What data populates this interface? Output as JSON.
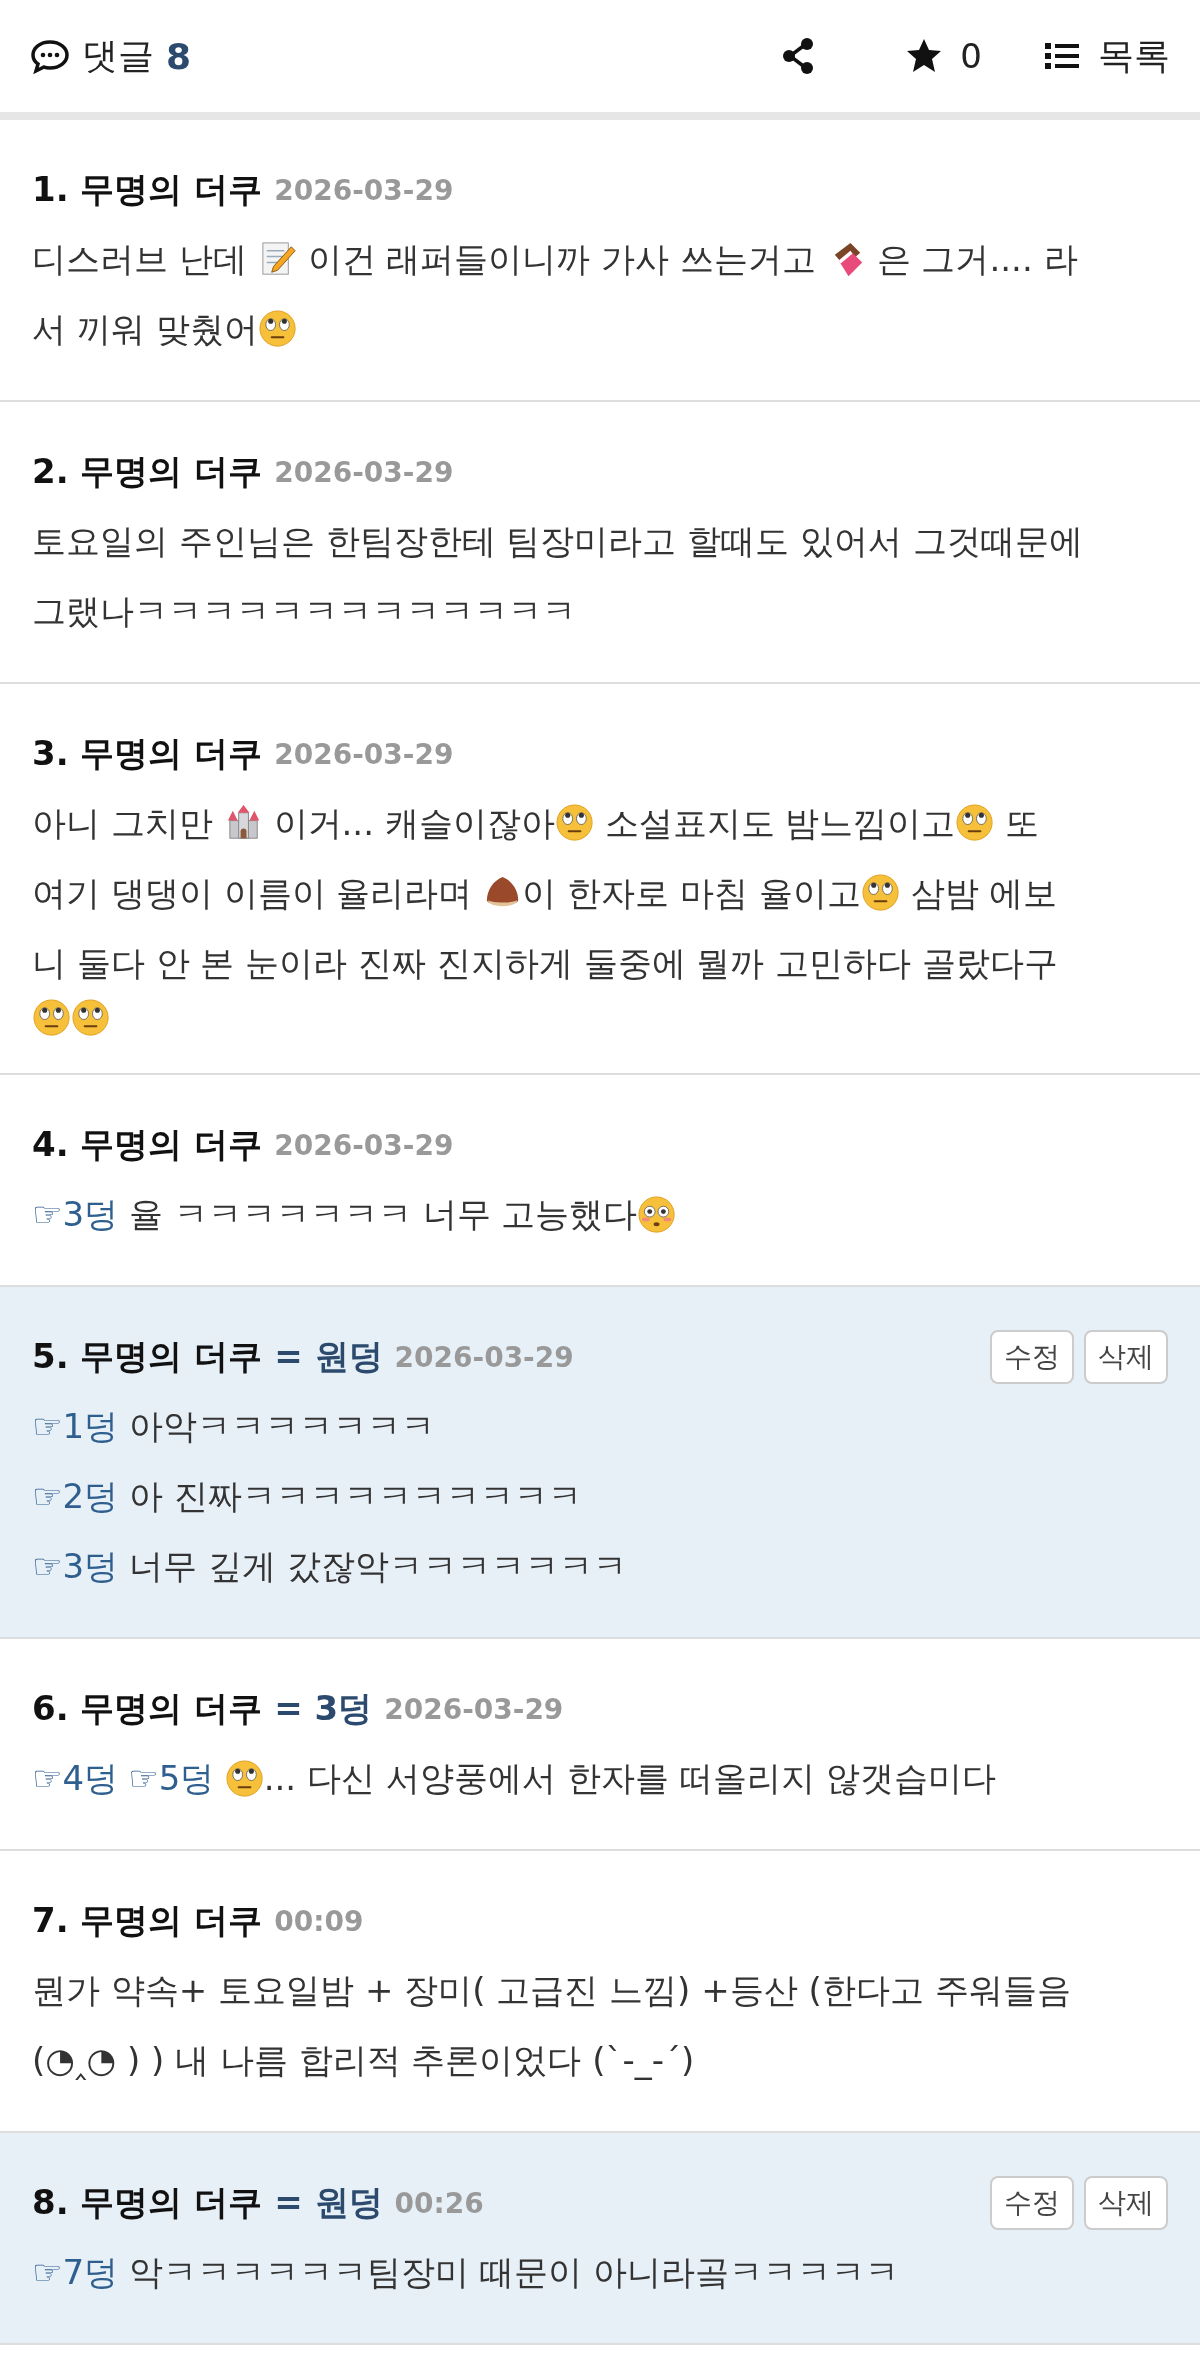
{
  "header": {
    "comments_label": "댓글",
    "comment_count": "8",
    "star_count": "0",
    "list_label": "목록"
  },
  "comments": [
    {
      "number": "1.",
      "author": "무명의 더쿠",
      "date": "2026-03-29",
      "highlighted": false,
      "lines": [
        [
          {
            "kind": "text",
            "text": "디스러브 난데 "
          },
          {
            "kind": "memo"
          },
          {
            "kind": "text",
            "text": " 이건 래퍼들이니까 가사 쓰는거고 "
          },
          {
            "kind": "chocolate"
          },
          {
            "kind": "text",
            "text": " 은 그거.... 라"
          }
        ],
        [
          {
            "kind": "text",
            "text": "서 끼워 맞췄어"
          },
          {
            "kind": "eyeroll"
          }
        ]
      ]
    },
    {
      "number": "2.",
      "author": "무명의 더쿠",
      "date": "2026-03-29",
      "highlighted": false,
      "lines": [
        [
          {
            "kind": "text",
            "text": "토요일의 주인님은 한팀장한테 팀장미라고 할때도 있어서 그것때문에"
          }
        ],
        [
          {
            "kind": "text",
            "text": "그랬나ㅋㅋㅋㅋㅋㅋㅋㅋㅋㅋㅋㅋㅋ"
          }
        ]
      ]
    },
    {
      "number": "3.",
      "author": "무명의 더쿠",
      "date": "2026-03-29",
      "highlighted": false,
      "lines": [
        [
          {
            "kind": "text",
            "text": "아니 그치만 "
          },
          {
            "kind": "castle"
          },
          {
            "kind": "text",
            "text": " 이거... 캐슬이잖아"
          },
          {
            "kind": "eyeroll"
          },
          {
            "kind": "text",
            "text": " 소설표지도 밤느낌이고"
          },
          {
            "kind": "eyeroll"
          },
          {
            "kind": "text",
            "text": " 또"
          }
        ],
        [
          {
            "kind": "text",
            "text": "여기 댕댕이 이름이 율리라며 "
          },
          {
            "kind": "chestnut"
          },
          {
            "kind": "text",
            "text": "이 한자로 마침 율이고"
          },
          {
            "kind": "eyeroll"
          },
          {
            "kind": "text",
            "text": " 삼밤 에보"
          }
        ],
        [
          {
            "kind": "text",
            "text": "니 둘다 안 본 눈이라 진짜 진지하게 둘중에 뭘까 고민하다 골랐다구"
          }
        ],
        [
          {
            "kind": "eyeroll"
          },
          {
            "kind": "eyeroll"
          }
        ]
      ]
    },
    {
      "number": "4.",
      "author": "무명의 더쿠",
      "date": "2026-03-29",
      "highlighted": false,
      "lines": [
        [
          {
            "kind": "ref",
            "text": "☞3덩"
          },
          {
            "kind": "text",
            "text": " 율 ㅋㅋㅋㅋㅋㅋㅋ 너무 고능했다"
          },
          {
            "kind": "flushed"
          }
        ]
      ]
    },
    {
      "number": "5.",
      "author": "무명의 더쿠",
      "tag": "= 원덩",
      "date": "2026-03-29",
      "highlighted": true,
      "buttons": [
        "수정",
        "삭제"
      ],
      "lines": [
        [
          {
            "kind": "ref",
            "text": "☞1덩"
          },
          {
            "kind": "text",
            "text": " 아악ㅋㅋㅋㅋㅋㅋㅋ"
          }
        ],
        [
          {
            "kind": "ref",
            "text": "☞2덩"
          },
          {
            "kind": "text",
            "text": " 아 진짜ㅋㅋㅋㅋㅋㅋㅋㅋㅋㅋ"
          }
        ],
        [
          {
            "kind": "ref",
            "text": "☞3덩"
          },
          {
            "kind": "text",
            "text": " 너무 깊게 갔잖악ㅋㅋㅋㅋㅋㅋㅋ"
          }
        ]
      ]
    },
    {
      "number": "6.",
      "author": "무명의 더쿠",
      "tag": "= 3덩",
      "date": "2026-03-29",
      "highlighted": false,
      "lines": [
        [
          {
            "kind": "ref",
            "text": "☞4덩"
          },
          {
            "kind": "ref",
            "text": "☞5덩"
          },
          {
            "kind": "eyeroll"
          },
          {
            "kind": "text",
            "text": "... 다신 서양풍에서 한자를 떠올리지 않갯습미다"
          }
        ]
      ]
    },
    {
      "number": "7.",
      "author": "무명의 더쿠",
      "date": "00:09",
      "highlighted": false,
      "lines": [
        [
          {
            "kind": "text",
            "text": "뭔가 약속+ 토요일밤 + 장미( 고급진 느낌) +등산 (한다고 주워들음"
          }
        ],
        [
          {
            "kind": "text",
            "text": "(◔‸◔ ) ) 내 나름 합리적 추론이었다 (ˋ-_-ˊ)"
          }
        ]
      ]
    },
    {
      "number": "8.",
      "author": "무명의 더쿠",
      "tag": "= 원덩",
      "date": "00:26",
      "highlighted": true,
      "buttons": [
        "수정",
        "삭제"
      ],
      "lines": [
        [
          {
            "kind": "ref",
            "text": "☞7덩"
          },
          {
            "kind": "text",
            "text": " 악ㅋㅋㅋㅋㅋㅋ팀장미 때문이 아니라곸ㅋㅋㅋㅋㅋ"
          }
        ]
      ]
    }
  ]
}
